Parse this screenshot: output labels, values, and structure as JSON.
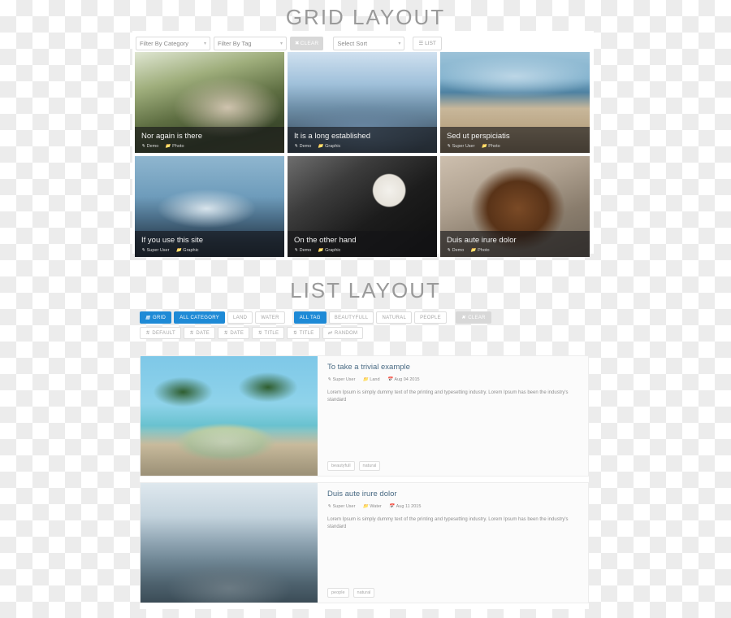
{
  "sections": {
    "grid_heading": "GRID LAYOUT",
    "list_heading": "LIST LAYOUT"
  },
  "grid_filter_bar": {
    "category_select": {
      "value": "Filter By Category",
      "caret": "chevron-down-icon"
    },
    "tag_select": {
      "value": "Filter By Tag",
      "caret": "chevron-down-icon"
    },
    "clear_button": {
      "label": "CLEAR",
      "icon": "close-icon"
    },
    "sort_select": {
      "value": "Select Sort",
      "caret": "chevron-down-icon"
    },
    "list_button": {
      "label": "LIST",
      "icon": "list-icon"
    }
  },
  "grid_cards": [
    {
      "title": "Nor again is there",
      "author": "Demo",
      "category": "Photo",
      "author_icon": "pencil-icon",
      "category_icon": "folder-icon",
      "photo": "ph-stairs"
    },
    {
      "title": "It is a long established",
      "author": "Demo",
      "category": "Graphic",
      "author_icon": "pencil-icon",
      "category_icon": "folder-icon",
      "photo": "ph-lake"
    },
    {
      "title": "Sed ut perspiciatis",
      "author": "Super User",
      "category": "Photo",
      "author_icon": "pencil-icon",
      "category_icon": "folder-icon",
      "photo": "ph-beach"
    },
    {
      "title": "If you use this site",
      "author": "Super User",
      "category": "Graphic",
      "author_icon": "pencil-icon",
      "category_icon": "folder-icon",
      "photo": "ph-wreck"
    },
    {
      "title": "On the other hand",
      "author": "Demo",
      "category": "Graphic",
      "author_icon": "pencil-icon",
      "category_icon": "folder-icon",
      "photo": "ph-coffee"
    },
    {
      "title": "Duis aute irure dolor",
      "author": "Demo",
      "category": "Photo",
      "author_icon": "pencil-icon",
      "category_icon": "folder-icon",
      "photo": "ph-dog"
    }
  ],
  "list_controls": {
    "filter_row": [
      {
        "label": "GRID",
        "active": true,
        "icon": "grid-icon"
      },
      {
        "label": "ALL CATEGORY",
        "active": true
      },
      {
        "label": "LAND",
        "active": false
      },
      {
        "label": "WATER",
        "active": false
      },
      {
        "label": "ALL TAG",
        "active": true,
        "spaced": true
      },
      {
        "label": "BEAUTYFULL",
        "active": false
      },
      {
        "label": "NATURAL",
        "active": false
      },
      {
        "label": "PEOPLE",
        "active": false
      },
      {
        "label": "CLEAR",
        "clear": true,
        "icon": "close-icon",
        "spaced": true
      }
    ],
    "sort_row": [
      {
        "label": "DEFAULT",
        "icon": "sort-icon"
      },
      {
        "label": "DATE",
        "icon": "sort-asc-icon"
      },
      {
        "label": "DATE",
        "icon": "sort-desc-icon"
      },
      {
        "label": "TITLE",
        "icon": "sort-asc-icon"
      },
      {
        "label": "TITLE",
        "icon": "sort-desc-icon"
      },
      {
        "label": "RANDOM",
        "icon": "shuffle-icon"
      }
    ]
  },
  "list_items": [
    {
      "title": "To take a trivial example",
      "author": "Super User",
      "category": "Land",
      "date": "Aug 04 2015",
      "author_icon": "pencil-icon",
      "category_icon": "folder-icon",
      "date_icon": "calendar-icon",
      "description": "Lorem Ipsum is simply dummy text of the printing and typesetting industry. Lorem Ipsum has been the industry's standard",
      "tags": [
        "beautyfull",
        "natural"
      ],
      "photo": "ph-van"
    },
    {
      "title": "Duis aute irure dolor",
      "author": "Super User",
      "category": "Water",
      "date": "Aug 11 2015",
      "author_icon": "pencil-icon",
      "category_icon": "folder-icon",
      "date_icon": "calendar-icon",
      "description": "Lorem Ipsum is simply dummy text of the printing and typesetting industry. Lorem Ipsum has been the industry's standard",
      "tags": [
        "people",
        "natural"
      ],
      "photo": "ph-mountain"
    }
  ],
  "colors": {
    "accent": "#1e8ad6",
    "muted_button": "#d8d8d8",
    "title_link": "#4a6b84",
    "heading": "#9a9a9a"
  }
}
